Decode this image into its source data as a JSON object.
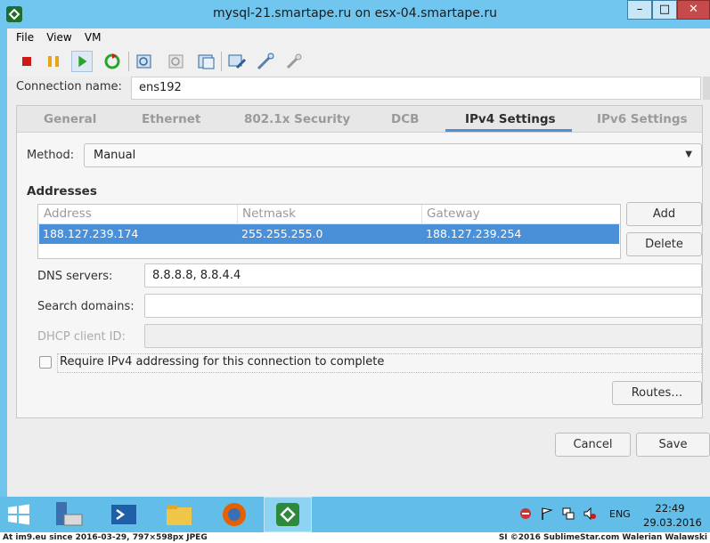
{
  "window": {
    "title": "mysql-21.smartape.ru on esx-04.smartape.ru",
    "min_label": "–",
    "max_label": "□",
    "close_label": "✕"
  },
  "menu": [
    "File",
    "View",
    "VM"
  ],
  "toolbar": {
    "icons": [
      "stop-icon",
      "pause-icon",
      "play-icon",
      "reset-icon",
      "snapshot-icon",
      "revert-snapshot-icon",
      "manage-snapshots-icon",
      "console-settings-icon",
      "edit-settings-icon",
      "connect-device-icon"
    ],
    "colors": {
      "stop": "#d01818",
      "pause": "#e8a317",
      "play": "#2aa52a"
    }
  },
  "connection": {
    "label": "Connection name:",
    "value": "ens192"
  },
  "tabs": [
    {
      "label": "General"
    },
    {
      "label": "Ethernet"
    },
    {
      "label": "802.1x Security"
    },
    {
      "label": "DCB"
    },
    {
      "label": "IPv4 Settings",
      "active": true
    },
    {
      "label": "IPv6 Settings"
    }
  ],
  "method": {
    "label": "Method:",
    "value": "Manual"
  },
  "addresses": {
    "heading": "Addresses",
    "columns": [
      "Address",
      "Netmask",
      "Gateway"
    ],
    "rows": [
      [
        "188.127.239.174",
        "255.255.255.0",
        "188.127.239.254"
      ]
    ],
    "add_label": "Add",
    "delete_label": "Delete"
  },
  "dns": {
    "label": "DNS servers:",
    "value": "8.8.8.8, 8.8.4.4"
  },
  "search_domains": {
    "label": "Search domains:",
    "value": ""
  },
  "dhcp_client_id": {
    "label": "DHCP client ID:",
    "value": ""
  },
  "require_ipv4": {
    "label": "Require IPv4 addressing for this connection to complete",
    "checked": false
  },
  "routes_label": "Routes…",
  "cancel_label": "Cancel",
  "save_label": "Save",
  "taskbar": {
    "lang": "ENG",
    "time": "22:49",
    "date": "29.03.2016"
  },
  "footer": {
    "left": "At im9.eu since 2016-03-29, 797×598px JPEG",
    "right": "SI ©2016 SublimeStar.com Walerian Walawski"
  },
  "accent_color": "#4a90d9"
}
